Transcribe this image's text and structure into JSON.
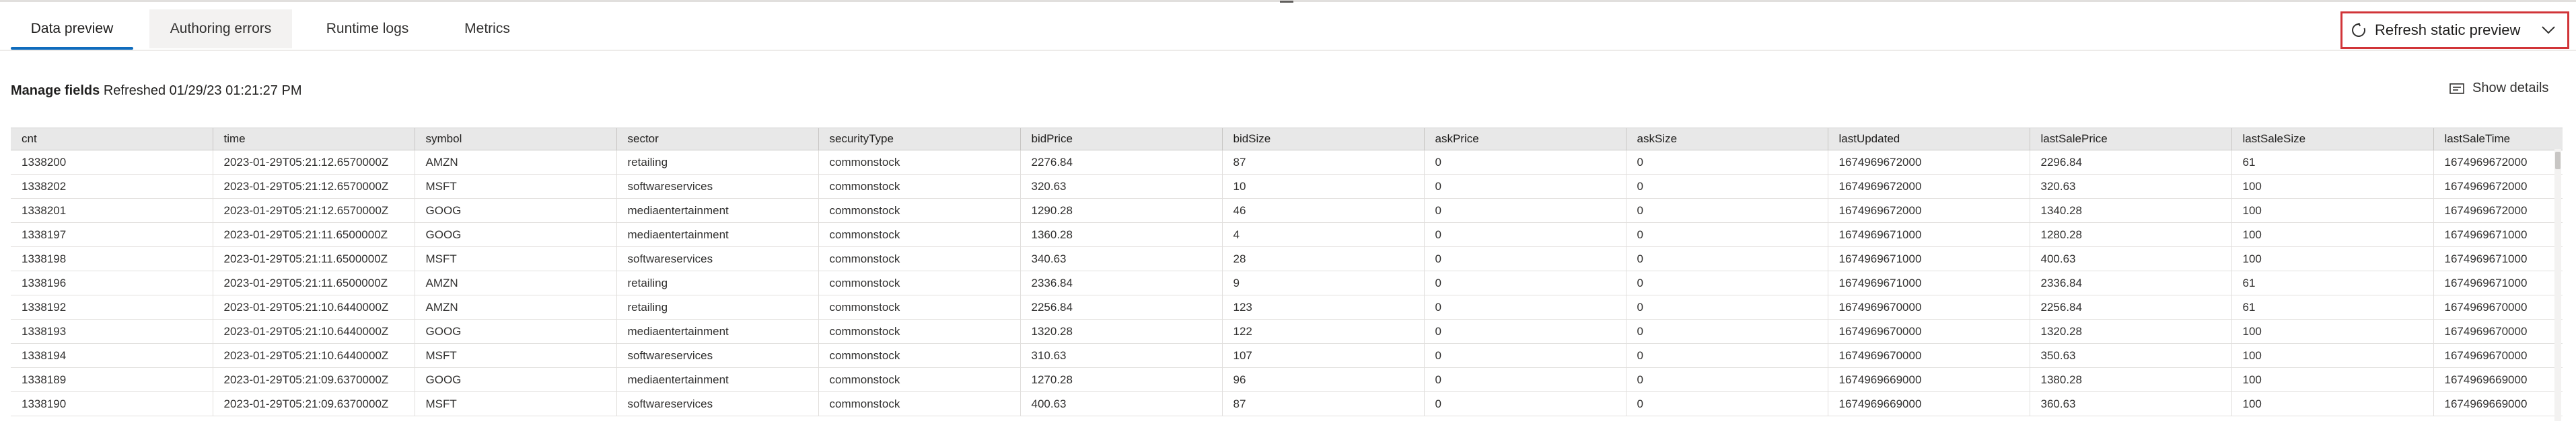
{
  "tabs": [
    {
      "label": "Data preview"
    },
    {
      "label": "Authoring errors"
    },
    {
      "label": "Runtime logs"
    },
    {
      "label": "Metrics"
    }
  ],
  "refresh": {
    "label": "Refresh static preview"
  },
  "manage": {
    "label": "Manage fields",
    "refreshed": "Refreshed 01/29/23 01:21:27 PM"
  },
  "show_details": {
    "label": "Show details"
  },
  "table": {
    "columns": [
      "cnt",
      "time",
      "symbol",
      "sector",
      "securityType",
      "bidPrice",
      "bidSize",
      "askPrice",
      "askSize",
      "lastUpdated",
      "lastSalePrice",
      "lastSaleSize",
      "lastSaleTime"
    ],
    "rows": [
      [
        "1338200",
        "2023-01-29T05:21:12.6570000Z",
        "AMZN",
        "retailing",
        "commonstock",
        "2276.84",
        "87",
        "0",
        "0",
        "1674969672000",
        "2296.84",
        "61",
        "1674969672000"
      ],
      [
        "1338202",
        "2023-01-29T05:21:12.6570000Z",
        "MSFT",
        "softwareservices",
        "commonstock",
        "320.63",
        "10",
        "0",
        "0",
        "1674969672000",
        "320.63",
        "100",
        "1674969672000"
      ],
      [
        "1338201",
        "2023-01-29T05:21:12.6570000Z",
        "GOOG",
        "mediaentertainment",
        "commonstock",
        "1290.28",
        "46",
        "0",
        "0",
        "1674969672000",
        "1340.28",
        "100",
        "1674969672000"
      ],
      [
        "1338197",
        "2023-01-29T05:21:11.6500000Z",
        "GOOG",
        "mediaentertainment",
        "commonstock",
        "1360.28",
        "4",
        "0",
        "0",
        "1674969671000",
        "1280.28",
        "100",
        "1674969671000"
      ],
      [
        "1338198",
        "2023-01-29T05:21:11.6500000Z",
        "MSFT",
        "softwareservices",
        "commonstock",
        "340.63",
        "28",
        "0",
        "0",
        "1674969671000",
        "400.63",
        "100",
        "1674969671000"
      ],
      [
        "1338196",
        "2023-01-29T05:21:11.6500000Z",
        "AMZN",
        "retailing",
        "commonstock",
        "2336.84",
        "9",
        "0",
        "0",
        "1674969671000",
        "2336.84",
        "61",
        "1674969671000"
      ],
      [
        "1338192",
        "2023-01-29T05:21:10.6440000Z",
        "AMZN",
        "retailing",
        "commonstock",
        "2256.84",
        "123",
        "0",
        "0",
        "1674969670000",
        "2256.84",
        "61",
        "1674969670000"
      ],
      [
        "1338193",
        "2023-01-29T05:21:10.6440000Z",
        "GOOG",
        "mediaentertainment",
        "commonstock",
        "1320.28",
        "122",
        "0",
        "0",
        "1674969670000",
        "1320.28",
        "100",
        "1674969670000"
      ],
      [
        "1338194",
        "2023-01-29T05:21:10.6440000Z",
        "MSFT",
        "softwareservices",
        "commonstock",
        "310.63",
        "107",
        "0",
        "0",
        "1674969670000",
        "350.63",
        "100",
        "1674969670000"
      ],
      [
        "1338189",
        "2023-01-29T05:21:09.6370000Z",
        "GOOG",
        "mediaentertainment",
        "commonstock",
        "1270.28",
        "96",
        "0",
        "0",
        "1674969669000",
        "1380.28",
        "100",
        "1674969669000"
      ],
      [
        "1338190",
        "2023-01-29T05:21:09.6370000Z",
        "MSFT",
        "softwareservices",
        "commonstock",
        "400.63",
        "87",
        "0",
        "0",
        "1674969669000",
        "360.63",
        "100",
        "1674969669000"
      ]
    ]
  },
  "icons": {
    "refresh": "refresh-icon",
    "chevron": "chevron-down-icon",
    "details": "details-panel-icon"
  },
  "colors": {
    "accent": "#0f6cbd",
    "highlight_border": "#d13438",
    "header_bg": "#e8e8e8"
  }
}
